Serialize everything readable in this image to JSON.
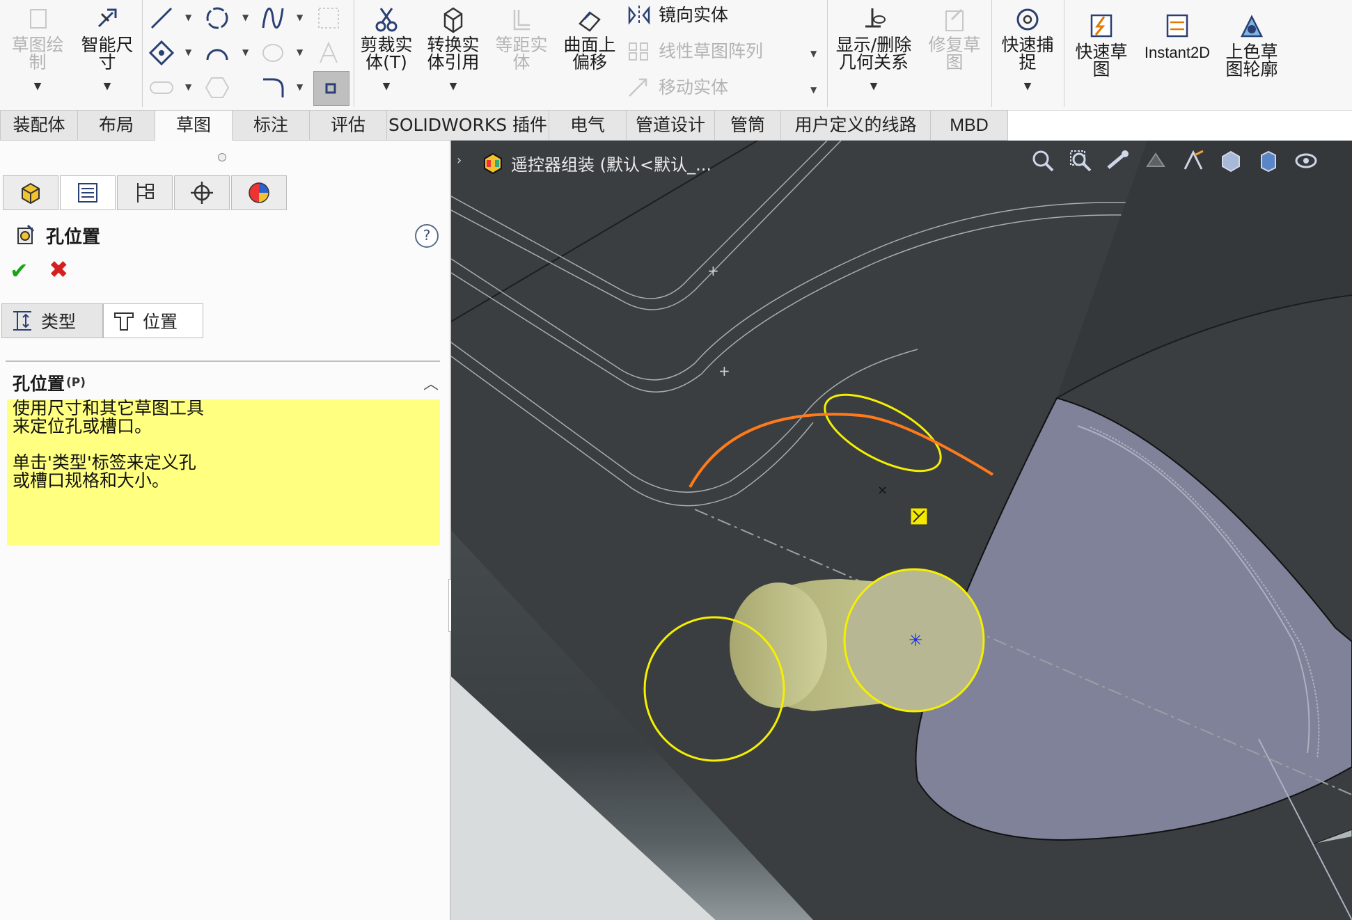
{
  "ribbon": {
    "sketch_draw": {
      "label": "草图绘\n制",
      "icon": "sketch-icon"
    },
    "smart_dim": {
      "label": "智能尺\n寸",
      "icon": "smart-dimension-icon"
    },
    "trim": {
      "label": "剪裁实\n体(T)",
      "icon": "scissors-icon"
    },
    "convert": {
      "label": "转换实\n体引用",
      "icon": "convert-entities-icon"
    },
    "offset": {
      "label": "等距实\n体",
      "icon": "offset-entities-icon"
    },
    "surface_offset": {
      "label": "曲面上\n偏移",
      "icon": "surface-offset-icon"
    },
    "mirror": {
      "label": "镜向实体",
      "icon": "mirror-icon"
    },
    "linear_pattern": {
      "label": "线性草图阵列",
      "icon": "linear-pattern-icon"
    },
    "move": {
      "label": "移动实体",
      "icon": "move-icon"
    },
    "relations": {
      "label": "显示/删除\n几何关系",
      "icon": "relations-icon"
    },
    "repair": {
      "label": "修复草\n图",
      "icon": "repair-sketch-icon"
    },
    "quick_snap": {
      "label": "快速捕\n捉",
      "icon": "quick-snap-icon"
    },
    "rapid_sketch": {
      "label": "快速草\n图",
      "icon": "rapid-sketch-icon"
    },
    "instant2d": {
      "label": "Instant2D",
      "icon": "instant2d-icon"
    },
    "shaded_contours": {
      "label": "上色草\n图轮廓",
      "icon": "shaded-contours-icon"
    }
  },
  "tabs": [
    "装配体",
    "布局",
    "草图",
    "标注",
    "评估",
    "SOLIDWORKS 插件",
    "电气",
    "管道设计",
    "管筒",
    "用户定义的线路",
    "MBD"
  ],
  "active_tab": "草图",
  "property_manager": {
    "title": "孔位置",
    "help": "?",
    "ok": "✔",
    "cancel": "✖",
    "subtabs": [
      {
        "label": "类型"
      },
      {
        "label": "位置"
      }
    ],
    "section_title": "孔位置",
    "section_key": "(P)",
    "message_lines": [
      "使用尺寸和其它草图工具",
      "来定位孔或槽口。",
      "",
      "单击'类型'标签来定义孔",
      "或槽口规格和大小。"
    ]
  },
  "viewport": {
    "doc_title": "遥控器组装 (默认<默认_..."
  },
  "colors": {
    "viewport_bg": "#3a3e41",
    "face": "#7f8299",
    "sketch_yellow": "#f5f000",
    "sketch_orange": "#ff7a1a",
    "message_bg": "#ffff80"
  }
}
